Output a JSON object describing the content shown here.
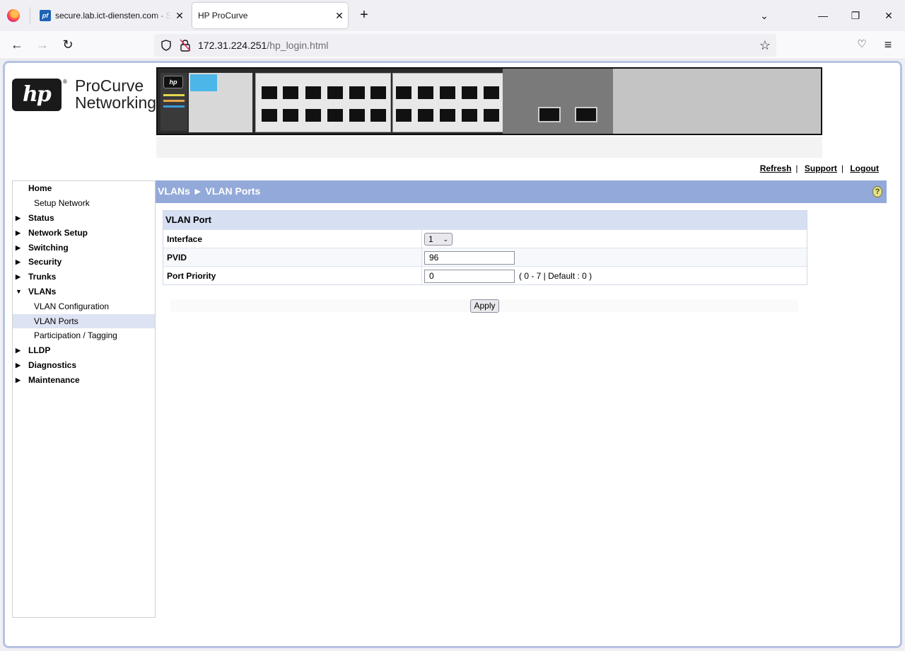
{
  "browser": {
    "tabs": [
      {
        "label": "secure.lab.ict-diensten.com - St",
        "favicon": "pf",
        "active": false
      },
      {
        "label": "HP ProCurve",
        "active": true
      }
    ],
    "url_host": "172.31.224.251",
    "url_path": "/hp_login.html"
  },
  "header": {
    "logo_text": "hp",
    "registered_mark": "®",
    "brand_line1": "ProCurve",
    "brand_line2": "Networking"
  },
  "toplinks": {
    "refresh": "Refresh",
    "support": "Support",
    "logout": "Logout",
    "separator": "|"
  },
  "sidebar": {
    "items": [
      {
        "label": "Home",
        "type": "top"
      },
      {
        "label": "Setup Network",
        "type": "sub"
      },
      {
        "label": "Status",
        "type": "collapsed"
      },
      {
        "label": "Network Setup",
        "type": "collapsed"
      },
      {
        "label": "Switching",
        "type": "collapsed"
      },
      {
        "label": "Security",
        "type": "collapsed"
      },
      {
        "label": "Trunks",
        "type": "collapsed"
      },
      {
        "label": "VLANs",
        "type": "expanded"
      },
      {
        "label": "VLAN Configuration",
        "type": "sub"
      },
      {
        "label": "VLAN Ports",
        "type": "sub",
        "active": true
      },
      {
        "label": "Participation / Tagging",
        "type": "sub"
      },
      {
        "label": "LLDP",
        "type": "collapsed"
      },
      {
        "label": "Diagnostics",
        "type": "collapsed"
      },
      {
        "label": "Maintenance",
        "type": "collapsed"
      }
    ]
  },
  "main": {
    "breadcrumb": "VLANs ► VLAN Ports",
    "help_icon": "?",
    "table_title": "VLAN Port",
    "rows": {
      "interface_label": "Interface",
      "interface_value": "1",
      "pvid_label": "PVID",
      "pvid_value": "96",
      "priority_label": "Port Priority",
      "priority_value": "0",
      "priority_hint": "( 0 - 7 | Default : 0 )"
    },
    "apply_label": "Apply"
  },
  "colors": {
    "titlebar": "#93a9d9",
    "table_head": "#d6e0f2",
    "active_nav": "#dde3f2"
  }
}
